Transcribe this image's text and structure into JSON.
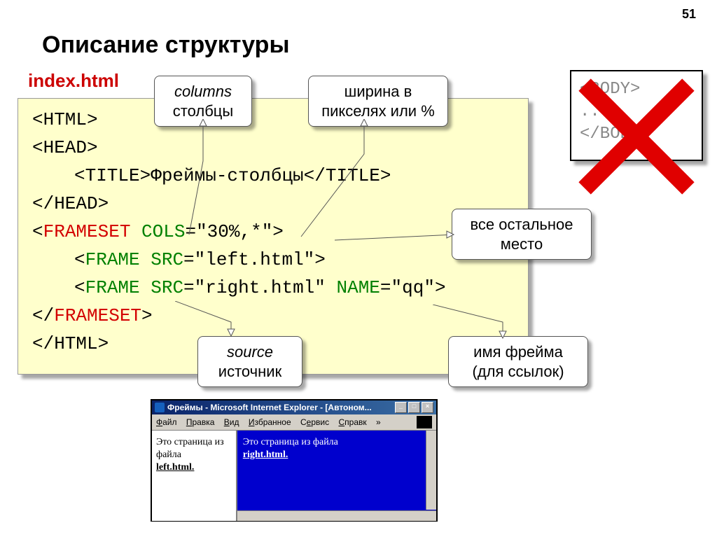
{
  "page_number": "51",
  "slide_title": "Описание структуры",
  "filename": "index.html",
  "code": {
    "html_open": "<HTML>",
    "head_open": "<HEAD>",
    "title_open": "<TITLE>",
    "title_text": "Фреймы-столбцы",
    "title_close": "</TITLE>",
    "head_close": "</HEAD>",
    "frameset_tag": "FRAMESET",
    "cols_attr": "COLS",
    "cols_val": "\"30%,*\"",
    "frame_tag": "FRAME",
    "src_attr": "SRC",
    "src_left": "\"left.html\"",
    "src_right": "\"right.html\"",
    "name_attr": "NAME",
    "name_val": "\"qq\"",
    "frameset_close": "FRAMESET",
    "html_close": "</HTML>"
  },
  "body_box": {
    "line1": "<BODY>",
    "line2": "...",
    "line3": "</BODY>"
  },
  "callouts": {
    "columns_en": "columns",
    "columns_ru": "столбцы",
    "width": "ширина в пикселях или %",
    "rest": "все остальное место",
    "source_en": "source",
    "source_ru": "источник",
    "name": "имя фрейма (для ссылок)"
  },
  "browser": {
    "title": "Фреймы - Microsoft Internet Explorer - [Автоном...",
    "menu": {
      "file": "Файл",
      "edit": "Правка",
      "view": "Вид",
      "fav": "Избранное",
      "service": "Сервис",
      "help": "Справк",
      "chevron": "»"
    },
    "left_text": "Это страница из файла",
    "left_file": "left.html.",
    "right_text": "Это страница из файла",
    "right_file": "right.html."
  }
}
